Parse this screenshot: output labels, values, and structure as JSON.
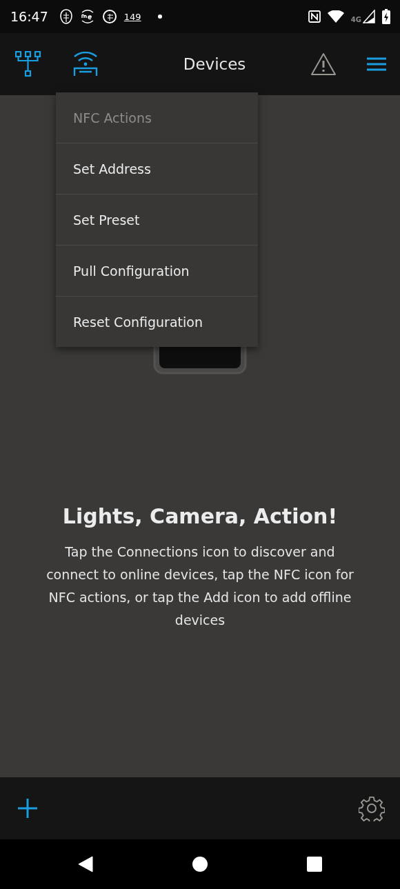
{
  "status_bar": {
    "time": "16:47",
    "notification_count": "149",
    "network": "4G"
  },
  "app_bar": {
    "title": "Devices"
  },
  "menu": {
    "items": [
      {
        "label": "NFC Actions",
        "kind": "header"
      },
      {
        "label": "Set Address",
        "kind": "action"
      },
      {
        "label": "Set Preset",
        "kind": "action"
      },
      {
        "label": "Pull Configuration",
        "kind": "action"
      },
      {
        "label": "Reset Configuration",
        "kind": "action"
      }
    ]
  },
  "empty_state": {
    "heading": "Lights, Camera, Action!",
    "message": "Tap the Connections icon to discover and connect to online devices, tap the NFC icon for NFC actions, or tap the Add icon to add offline devices"
  }
}
